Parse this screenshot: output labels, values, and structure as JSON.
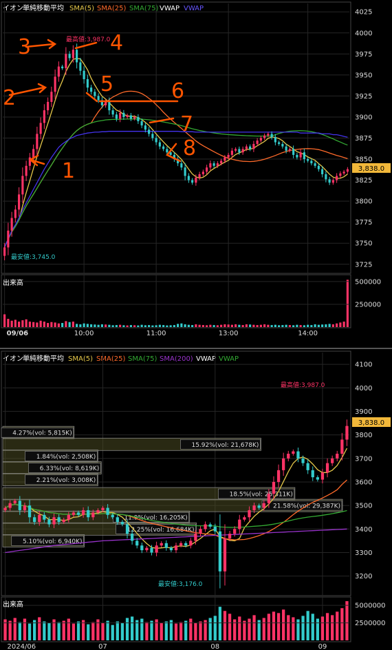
{
  "colors": {
    "background": "#000000",
    "grid": "#262626",
    "up": "#ff3366",
    "down": "#33cccc",
    "sma5": "#e6c84a",
    "sma25": "#ff6a2a",
    "sma75": "#33aa33",
    "sma200": "#9933cc",
    "vwap_intraday": "#4433ee",
    "vwap_daily": "#33aa33",
    "annotation": "#ff5500",
    "price_label": "#f2b83a",
    "profile_fill": "#4a4a22"
  },
  "chart_data": [
    {
      "type": "candlestick",
      "name": "intraday",
      "header": {
        "symbol": "イオン",
        "indicator": "単純移動平均",
        "sma5": "SMA(5)",
        "sma25": "SMA(25)",
        "sma75": "SMA(75)",
        "vwap1": "VWAP",
        "vwap2": "VWAP"
      },
      "ylim": [
        3715,
        4035
      ],
      "yticks": [
        3725,
        3750,
        3775,
        3800,
        3825,
        3850,
        3875,
        3900,
        3925,
        3950,
        3975,
        4000,
        4025
      ],
      "ytick_labels": [
        "3725",
        "3750",
        "3775",
        "3800",
        "3825",
        "3850",
        "3875",
        "3900",
        "3925",
        "3950",
        "3975",
        "4000",
        "4025"
      ],
      "xtick_labels": [
        "09/06",
        "10:00",
        "11:00",
        "13:00",
        "14:00"
      ],
      "xtick_index": [
        0,
        22,
        42,
        62,
        84
      ],
      "last_price": "3,838.0",
      "high_label": "最高値:3,987.0",
      "low_label": "最安値:3,745.0",
      "high_index": 19,
      "low_index": 0,
      "closes": [
        3745,
        3765,
        3780,
        3790,
        3808,
        3830,
        3842,
        3852,
        3862,
        3880,
        3893,
        3908,
        3918,
        3930,
        3948,
        3960,
        3958,
        3975,
        3970,
        3980,
        3965,
        3955,
        3945,
        3935,
        3930,
        3925,
        3920,
        3914,
        3918,
        3908,
        3903,
        3898,
        3905,
        3900,
        3902,
        3898,
        3900,
        3895,
        3890,
        3885,
        3880,
        3875,
        3870,
        3865,
        3862,
        3858,
        3855,
        3850,
        3845,
        3840,
        3830,
        3825,
        3822,
        3828,
        3832,
        3835,
        3840,
        3845,
        3842,
        3845,
        3848,
        3852,
        3855,
        3860,
        3862,
        3858,
        3862,
        3865,
        3862,
        3868,
        3872,
        3875,
        3878,
        3880,
        3876,
        3870,
        3868,
        3865,
        3860,
        3862,
        3855,
        3852,
        3858,
        3850,
        3848,
        3845,
        3842,
        3838,
        3832,
        3826,
        3822,
        3825,
        3830,
        3833,
        3835,
        3838
      ],
      "vwap": [
        3745,
        3755,
        3765,
        3772,
        3780,
        3790,
        3798,
        3806,
        3814,
        3822,
        3830,
        3838,
        3845,
        3852,
        3858,
        3864,
        3868,
        3871,
        3874,
        3876,
        3878,
        3879,
        3880,
        3881,
        3881.5,
        3882,
        3882,
        3882.5,
        3882.5,
        3883,
        3883,
        3883,
        3883,
        3883,
        3883,
        3883,
        3883,
        3883,
        3883,
        3883,
        3883,
        3883,
        3883,
        3883,
        3883,
        3883,
        3883,
        3883,
        3883,
        3882.5,
        3882.5,
        3882.5,
        3882.5,
        3882,
        3882,
        3882,
        3882,
        3882,
        3882,
        3882,
        3882,
        3882,
        3882,
        3882,
        3882,
        3882,
        3882,
        3882,
        3882,
        3882,
        3882,
        3882,
        3882,
        3882,
        3882,
        3882,
        3882,
        3882,
        3882,
        3882,
        3882,
        3882,
        3881,
        3881,
        3881,
        3881,
        3881,
        3881,
        3880,
        3880,
        3880,
        3879,
        3879,
        3878,
        3877,
        3876
      ],
      "volume_label": "出来高",
      "volume_ticks": [
        250000,
        500000
      ],
      "volume_tick_labels": [
        "250000",
        "500000"
      ],
      "volume_ylim": [
        0,
        560000
      ],
      "volumes": [
        140000,
        90000,
        70000,
        80000,
        60000,
        75000,
        85000,
        60000,
        55000,
        50000,
        70000,
        60000,
        45000,
        55000,
        50000,
        40000,
        45000,
        65000,
        55000,
        60000,
        35000,
        30000,
        40000,
        35000,
        30000,
        28000,
        25000,
        30000,
        28000,
        25000,
        20000,
        22000,
        25000,
        20000,
        18000,
        22000,
        20000,
        18000,
        25000,
        20000,
        22000,
        18000,
        20000,
        25000,
        22000,
        18000,
        20000,
        22000,
        35000,
        40000,
        30000,
        25000,
        22000,
        30000,
        25000,
        22000,
        20000,
        25000,
        22000,
        20000,
        25000,
        30000,
        28000,
        25000,
        30000,
        25000,
        22000,
        30000,
        28000,
        25000,
        22000,
        25000,
        30000,
        25000,
        22000,
        25000,
        20000,
        22000,
        25000,
        22000,
        20000,
        25000,
        22000,
        20000,
        25000,
        22000,
        30000,
        25000,
        28000,
        30000,
        35000,
        30000,
        40000,
        50000,
        60000,
        520000
      ],
      "annotations": [
        "3",
        "4",
        "2",
        "5",
        "6",
        "7",
        "8",
        "1"
      ]
    },
    {
      "type": "candlestick",
      "name": "daily",
      "header": {
        "symbol": "イオン",
        "indicator": "単純移動平均",
        "sma5": "SMA(5)",
        "sma25": "SMA(25)",
        "sma75": "SMA(75)",
        "sma200": "SMA(200)",
        "vwap1": "VWAP",
        "vwap2": "VWAP"
      },
      "ylim": [
        3120,
        4150
      ],
      "yticks": [
        3200,
        3300,
        3400,
        3500,
        3600,
        3700,
        3800,
        3900,
        4000,
        4100
      ],
      "ytick_labels": [
        "3200",
        "3300",
        "3400",
        "3500",
        "3600",
        "3700",
        "3800",
        "3900",
        "4000",
        "4100"
      ],
      "xtick_labels": [
        "2024/06",
        "07",
        "08",
        "09"
      ],
      "xtick_index": [
        0,
        20,
        43,
        65
      ],
      "last_price": "3,838.0",
      "high_label": "最高値:3,987.0",
      "low_label": "最安値:3,176.0",
      "high_index": 70,
      "low_index": 44,
      "closes": [
        3490,
        3510,
        3520,
        3480,
        3500,
        3450,
        3430,
        3460,
        3440,
        3420,
        3450,
        3430,
        3440,
        3460,
        3470,
        3460,
        3480,
        3450,
        3470,
        3480,
        3490,
        3460,
        3450,
        3430,
        3420,
        3380,
        3350,
        3330,
        3310,
        3320,
        3300,
        3330,
        3340,
        3320,
        3310,
        3330,
        3340,
        3330,
        3350,
        3380,
        3400,
        3420,
        3410,
        3390,
        3220,
        3360,
        3380,
        3400,
        3440,
        3450,
        3480,
        3500,
        3490,
        3510,
        3550,
        3600,
        3650,
        3700,
        3720,
        3730,
        3700,
        3680,
        3650,
        3620,
        3610,
        3640,
        3680,
        3700,
        3720,
        3780,
        3838
      ],
      "sma200": [
        3300,
        3303,
        3306,
        3309,
        3312,
        3315,
        3318,
        3321,
        3324,
        3327,
        3330,
        3332,
        3334,
        3336,
        3338,
        3340,
        3342,
        3344,
        3346,
        3348,
        3350,
        3351,
        3352,
        3353,
        3354,
        3355,
        3356,
        3357,
        3358,
        3359,
        3360,
        3361,
        3362,
        3363,
        3364,
        3365,
        3366,
        3367,
        3368,
        3369,
        3370,
        3371,
        3372,
        3373,
        3374,
        3375,
        3376,
        3377,
        3378,
        3379,
        3380,
        3381,
        3382,
        3383,
        3384,
        3385,
        3386,
        3387,
        3388,
        3389,
        3390,
        3391,
        3392,
        3393,
        3394,
        3395,
        3396,
        3397,
        3398,
        3399,
        3400
      ],
      "volume_label": "出来高",
      "volume_ticks": [
        2500000,
        5000000
      ],
      "volume_tick_labels": [
        "2500000",
        "5000000"
      ],
      "volume_ylim": [
        0,
        6000000
      ],
      "volumes": [
        3000000,
        2800000,
        3200000,
        2600000,
        3100000,
        2400000,
        2900000,
        3300000,
        2700000,
        2500000,
        3000000,
        2600000,
        2800000,
        3100000,
        2400000,
        2700000,
        2900000,
        2300000,
        2600000,
        3000000,
        2500000,
        2800000,
        2200000,
        2700000,
        2500000,
        3200000,
        3400000,
        2900000,
        3100000,
        2600000,
        2800000,
        3000000,
        2500000,
        2700000,
        2900000,
        2400000,
        2600000,
        2800000,
        3100000,
        2500000,
        2700000,
        2900000,
        3200000,
        3500000,
        4800000,
        4200000,
        3800000,
        3000000,
        3400000,
        2800000,
        3100000,
        3600000,
        2900000,
        3200000,
        3800000,
        4100000,
        3900000,
        4400000,
        3600000,
        3300000,
        3000000,
        3500000,
        4200000,
        3800000,
        3100000,
        3400000,
        3900000,
        3600000,
        4100000,
        4600000,
        5600000
      ],
      "volume_profile": [
        {
          "label": "4.27%(vol: 5,815K)",
          "price": 3810,
          "width_pct": 0.21
        },
        {
          "label": "15.92%(vol: 21,678K)",
          "price": 3760,
          "width_pct": 0.76
        },
        {
          "label": "1.84%(vol: 2,508K)",
          "price": 3710,
          "width_pct": 0.28
        },
        {
          "label": "6.33%(vol: 8,619K)",
          "price": 3660,
          "width_pct": 0.29
        },
        {
          "label": "2.21%(vol: 3,008K)",
          "price": 3610,
          "width_pct": 0.28
        },
        {
          "label": "18.5%(vol: 25,311K)",
          "price": 3550,
          "width_pct": 0.86
        },
        {
          "label": "21.58%(vol: 29,387K)",
          "price": 3500,
          "width_pct": 1.0
        },
        {
          "label": "11.9%(vol: 16,205K)",
          "price": 3450,
          "width_pct": 0.55
        },
        {
          "label": "12.25%(vol: 16,684K)",
          "price": 3400,
          "width_pct": 0.57
        },
        {
          "label": "5.10%(vol: 6,940K)",
          "price": 3350,
          "width_pct": 0.24
        }
      ]
    }
  ]
}
